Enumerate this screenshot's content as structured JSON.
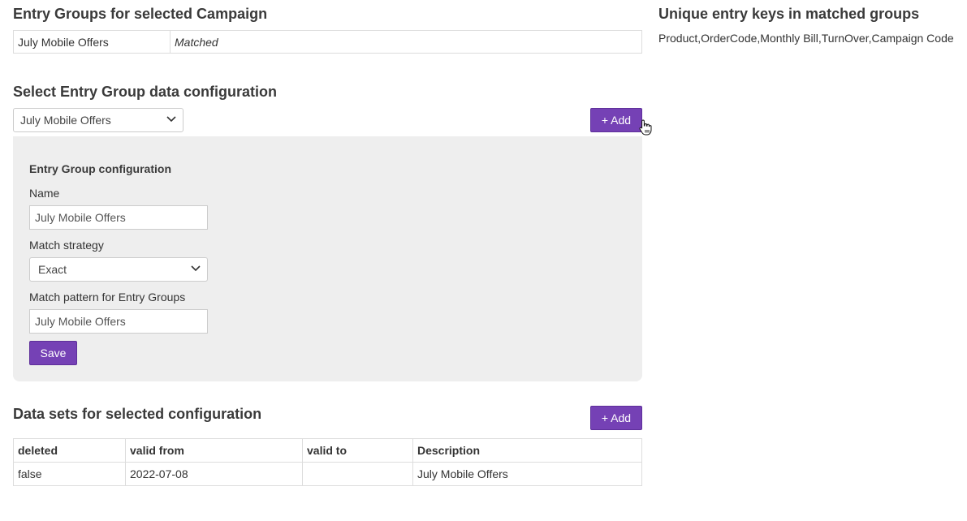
{
  "entry_groups": {
    "title": "Entry Groups for selected Campaign",
    "rows": [
      {
        "name": "July Mobile Offers",
        "status": "Matched"
      }
    ]
  },
  "config_select": {
    "title": "Select Entry Group data configuration",
    "selected": "July Mobile Offers",
    "add_label": "+ Add"
  },
  "config_panel": {
    "heading": "Entry Group configuration",
    "name_label": "Name",
    "name_value": "July Mobile Offers",
    "strategy_label": "Match strategy",
    "strategy_value": "Exact",
    "pattern_label": "Match pattern for Entry Groups",
    "pattern_value": "July Mobile Offers",
    "save_label": "Save"
  },
  "datasets": {
    "title": "Data sets for selected configuration",
    "add_label": "+ Add",
    "columns": [
      "deleted",
      "valid from",
      "valid to",
      "Description"
    ],
    "rows": [
      {
        "deleted": "false",
        "valid_from": "2022-07-08",
        "valid_to": "",
        "description": "July Mobile Offers"
      }
    ]
  },
  "unique_keys": {
    "title": "Unique entry keys in matched groups",
    "keys": "Product,OrderCode,Monthly Bill,TurnOver,Campaign Code"
  },
  "colors": {
    "accent": "#7541b5",
    "panel_bg": "#eeeeee"
  },
  "icons": {
    "select_chevron": "chevron-down-icon",
    "pointer": "hand-cursor-icon"
  }
}
